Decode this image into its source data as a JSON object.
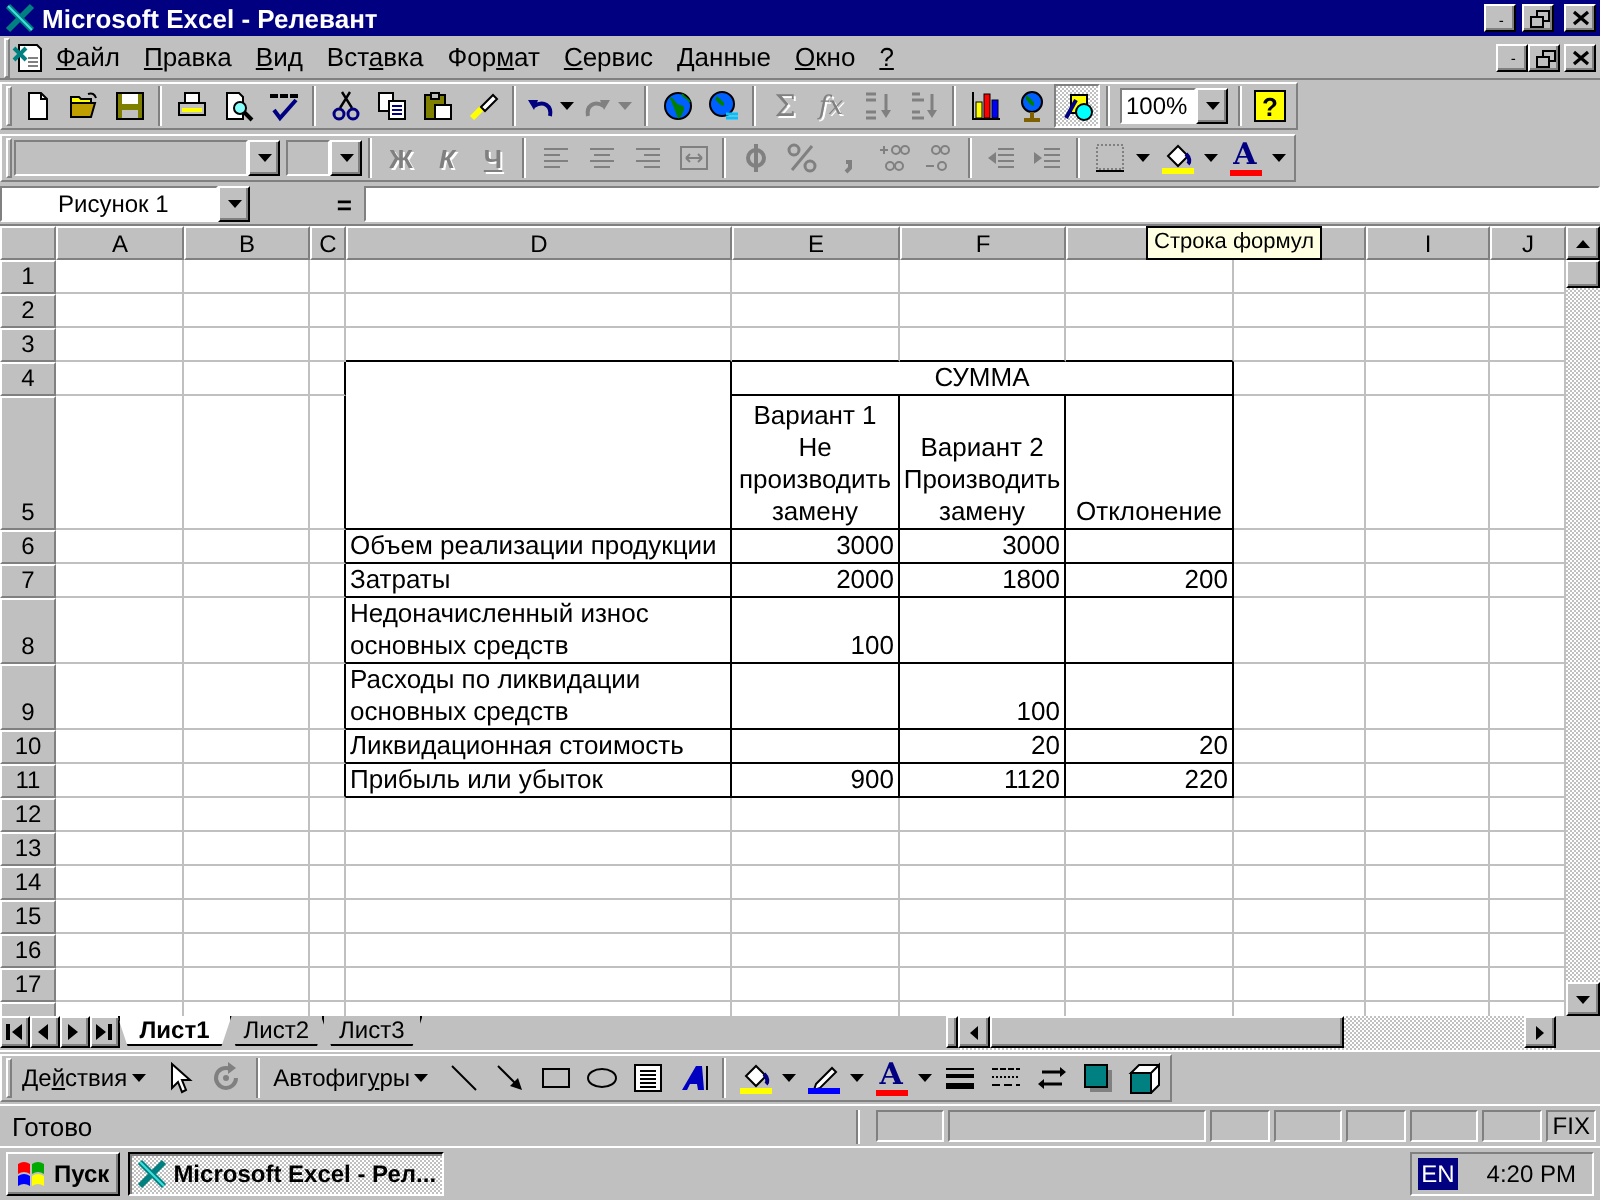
{
  "window": {
    "title": "Microsoft Excel - Релевант"
  },
  "menu": [
    {
      "key": "Ф",
      "after": "айл"
    },
    {
      "key": "П",
      "after": "равка"
    },
    {
      "key": "В",
      "after": "ид"
    },
    {
      "before": "Вст",
      "key": "а",
      "after": "вка"
    },
    {
      "before": "Фор",
      "key": "м",
      "after": "ат"
    },
    {
      "key": "С",
      "after": "ервис"
    },
    {
      "key": "Д",
      "after": "анные"
    },
    {
      "key": "О",
      "after": "кно"
    },
    {
      "key": "?"
    }
  ],
  "standard_toolbar": {
    "redo_disabled": true,
    "autosum": "Σ",
    "function": "fx",
    "formula_tools_disabled": true,
    "drawing_pressed": true,
    "zoom": "100%",
    "help": "?"
  },
  "formatting_toolbar": {
    "disabled": true,
    "style_buttons": [
      "Ж",
      "К",
      "Ч"
    ],
    "font_color": "A"
  },
  "formula_bar": {
    "name_box": "Рисунок 1",
    "equals": "="
  },
  "sheet": {
    "column_headers_left": [
      "A",
      "B",
      "C",
      "D",
      "E",
      "F"
    ],
    "column_headers_right": [
      "I",
      "J"
    ],
    "row_headers": [
      "1",
      "2",
      "3",
      "4",
      "5",
      "6",
      "7",
      "8",
      "9",
      "10",
      "11",
      "12",
      "13",
      "14",
      "15",
      "16",
      "17"
    ],
    "tooltip": "Строка формул",
    "table": {
      "group_header": "СУММА",
      "column_headers": [
        "Вариант 1 Не производить замену",
        "Вариант 2 Производить замену",
        "Отклонение"
      ],
      "rows": [
        {
          "label": "Объем реализации продукции",
          "cells": [
            {
              "value": "3000"
            },
            {
              "value": "3000"
            },
            {}
          ]
        },
        {
          "label": "Затраты",
          "cells": [
            {
              "value": "2000"
            },
            {
              "value": "1800"
            },
            {
              "value": "200"
            }
          ]
        },
        {
          "label": "Недоначисленный износ основных средств",
          "cells": [
            {
              "value": "100"
            },
            {},
            {}
          ]
        },
        {
          "label": "Расходы по ликвидации основных средств",
          "cells": [
            {},
            {
              "value": "100"
            },
            {}
          ]
        },
        {
          "label": "Ликвидационная стоимость",
          "cells": [
            {},
            {
              "value": "20"
            },
            {
              "value": "20"
            }
          ]
        },
        {
          "label": "Прибыль или убыток",
          "cells": [
            {
              "value": "900"
            },
            {
              "value": "1120"
            },
            {
              "value": "220"
            }
          ]
        }
      ]
    }
  },
  "sheet_tabs": [
    {
      "label": "Лист1",
      "selected": true
    },
    {
      "label": "Лист2",
      "selected": false
    },
    {
      "label": "Лист3",
      "selected": false
    }
  ],
  "drawing_toolbar": {
    "actions": {
      "before": "Де",
      "key": "й",
      "after": "ствия"
    },
    "rotate_disabled": true,
    "autoshapes": {
      "before": "Автофиг",
      "key": "у",
      "after": "ры"
    },
    "font_color": "A"
  },
  "status_bar": {
    "text": "Готово",
    "indicator": "FIX"
  },
  "taskbar": {
    "start": "Пуск",
    "tasks": [
      {
        "label": "Microsoft Excel - Рел...",
        "selected": true
      }
    ],
    "language": "EN",
    "clock": "4:20 PM"
  }
}
